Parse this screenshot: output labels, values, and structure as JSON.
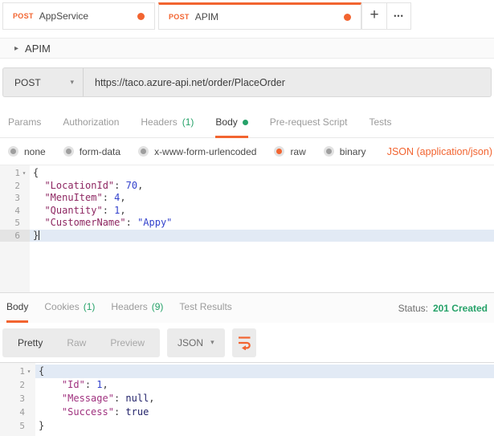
{
  "icons": {
    "fold": "▾",
    "collapse_caret": "▸",
    "dropdown_caret": "▾",
    "plus": "+",
    "more": "•••"
  },
  "colors": {
    "accent_orange": "#f26430",
    "success_green": "#26a269",
    "key_request": "#8e2762",
    "key_response": "#a0327f",
    "value_blue": "#3342cc",
    "keyword_navy": "#24246b",
    "active_line_blue": "#e2eaf5"
  },
  "tabbar": {
    "tabs": [
      {
        "method": "POST",
        "title": "AppService"
      },
      {
        "method": "POST",
        "title": "APIM"
      }
    ]
  },
  "collection_header": {
    "title": "APIM"
  },
  "request_bar": {
    "method": "POST",
    "url": "https://taco.azure-api.net/order/PlaceOrder"
  },
  "request_tabs": {
    "params": "Params",
    "authorization": "Authorization",
    "headers": "Headers",
    "headers_count": "(1)",
    "body": "Body",
    "prerequest": "Pre-request Script",
    "tests": "Tests"
  },
  "body_modes": {
    "none": "none",
    "form_data": "form-data",
    "urlencoded": "x-www-form-urlencoded",
    "raw": "raw",
    "binary": "binary",
    "selected": "raw",
    "content_type": "JSON (application/json)"
  },
  "request_editor": {
    "lines": [
      {
        "n": "1",
        "fold": true,
        "tokens": [
          [
            "pln",
            "{"
          ]
        ]
      },
      {
        "n": "2",
        "tokens": [
          [
            "pln",
            "  "
          ],
          [
            "key",
            "\"LocationId\""
          ],
          [
            "pln",
            ": "
          ],
          [
            "num",
            "70"
          ],
          [
            "pln",
            ","
          ]
        ]
      },
      {
        "n": "3",
        "tokens": [
          [
            "pln",
            "  "
          ],
          [
            "key",
            "\"MenuItem\""
          ],
          [
            "pln",
            ": "
          ],
          [
            "num",
            "4"
          ],
          [
            "pln",
            ","
          ]
        ]
      },
      {
        "n": "4",
        "tokens": [
          [
            "pln",
            "  "
          ],
          [
            "key",
            "\"Quantity\""
          ],
          [
            "pln",
            ": "
          ],
          [
            "num",
            "1"
          ],
          [
            "pln",
            ","
          ]
        ]
      },
      {
        "n": "5",
        "tokens": [
          [
            "pln",
            "  "
          ],
          [
            "key",
            "\"CustomerName\""
          ],
          [
            "pln",
            ": "
          ],
          [
            "str",
            "\"Appy\""
          ]
        ]
      },
      {
        "n": "6",
        "tokens": [
          [
            "pln",
            "}"
          ]
        ],
        "cursor": true,
        "gutterActive": true,
        "lineActive": true
      }
    ]
  },
  "response_meta": {
    "body": "Body",
    "cookies": "Cookies",
    "cookies_count": "(1)",
    "headers": "Headers",
    "headers_count": "(9)",
    "test_results": "Test Results",
    "status_label": "Status:",
    "status_value": "201 Created"
  },
  "response_views": {
    "pretty": "Pretty",
    "raw": "Raw",
    "preview": "Preview",
    "active": "Pretty",
    "format": "JSON"
  },
  "response_editor": {
    "lines": [
      {
        "n": "1",
        "fold": true,
        "tokens": [
          [
            "pln",
            "{"
          ]
        ],
        "lineActive": true
      },
      {
        "n": "2",
        "tokens": [
          [
            "pln",
            "    "
          ],
          [
            "key",
            "\"Id\""
          ],
          [
            "pln",
            ": "
          ],
          [
            "num",
            "1"
          ],
          [
            "pln",
            ","
          ]
        ]
      },
      {
        "n": "3",
        "tokens": [
          [
            "pln",
            "    "
          ],
          [
            "key",
            "\"Message\""
          ],
          [
            "pln",
            ": "
          ],
          [
            "kw",
            "null"
          ],
          [
            "pln",
            ","
          ]
        ]
      },
      {
        "n": "4",
        "tokens": [
          [
            "pln",
            "    "
          ],
          [
            "key",
            "\"Success\""
          ],
          [
            "pln",
            ": "
          ],
          [
            "kw",
            "true"
          ]
        ]
      },
      {
        "n": "5",
        "tokens": [
          [
            "pln",
            "}"
          ]
        ]
      }
    ]
  }
}
